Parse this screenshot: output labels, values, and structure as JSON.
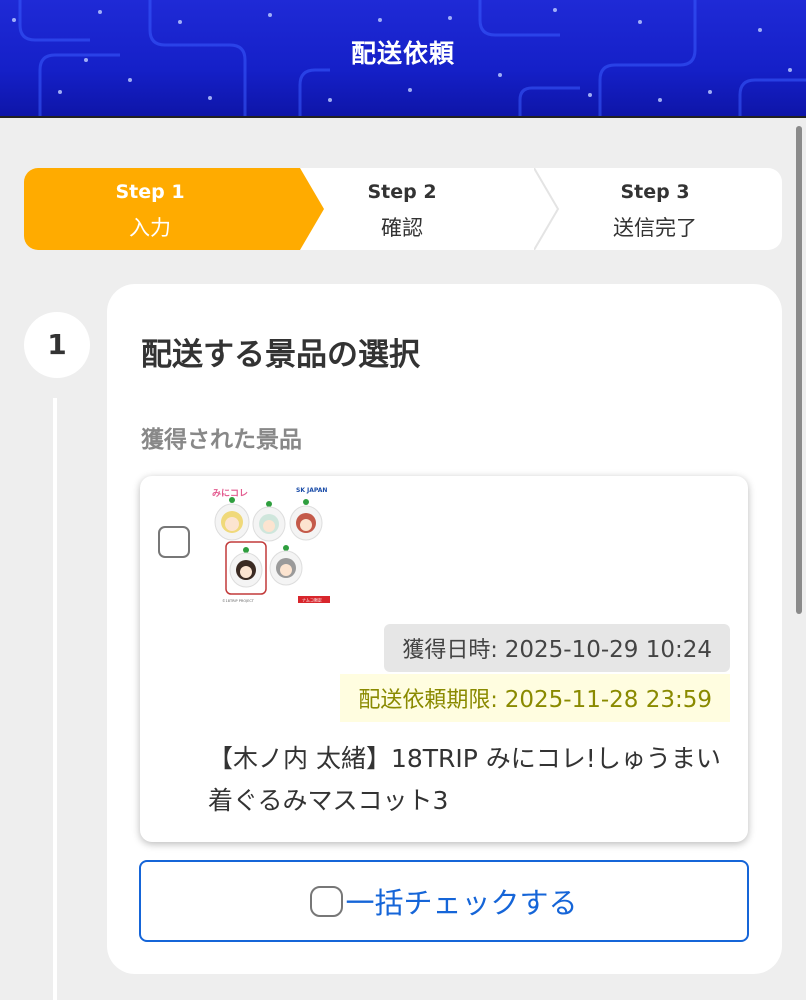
{
  "header": {
    "title": "配送依頼"
  },
  "stepper": {
    "steps": [
      {
        "number": "Step 1",
        "label": "入力",
        "state": "active"
      },
      {
        "number": "Step 2",
        "label": "確認",
        "state": "inactive"
      },
      {
        "number": "Step 3",
        "label": "送信完了",
        "state": "inactive"
      }
    ],
    "active_color": "#ffab00"
  },
  "section": {
    "number": "1",
    "title": "配送する景品の選択",
    "subheading": "獲得された景品"
  },
  "prize": {
    "checked": false,
    "image": {
      "logo_text": "みにコレ",
      "brand_text": "SK JAPAN",
      "footer_left": "©18TRIP PROJECT",
      "footer_right": "ナムコ限定"
    },
    "acquired_label": "獲得日時: ",
    "acquired_value": "2025-10-29 10:24",
    "deadline_label": "配送依頼期限: ",
    "deadline_value": "2025-11-28 23:59",
    "name": "【木ノ内 太緒】18TRIP みにコレ!しゅうまい着ぐるみマスコット3"
  },
  "bulk_check": {
    "label": "一括チェックする",
    "color": "#1565d8"
  }
}
